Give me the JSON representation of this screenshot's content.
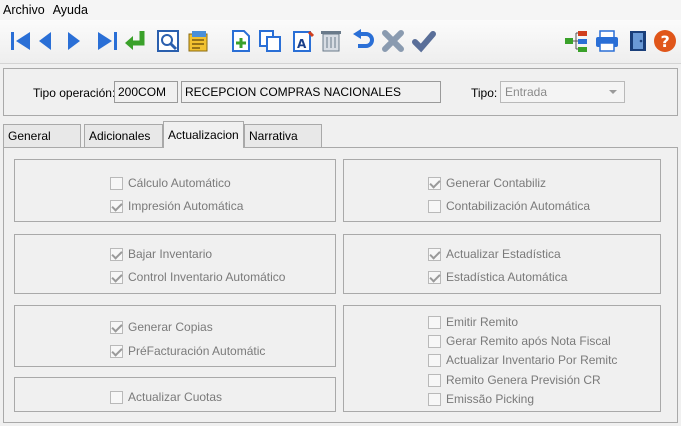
{
  "menu": {
    "archivo": "Archivo",
    "ayuda": "Ayuda"
  },
  "toolbar": {
    "icons": [
      "first-icon",
      "prev-icon",
      "next-icon",
      "last-icon",
      "enter-icon",
      "preview-icon",
      "report-icon",
      "new-icon",
      "copy-icon",
      "edit-icon",
      "delete-icon",
      "undo-icon",
      "cancel-icon",
      "confirm-icon",
      "tree-icon",
      "print-icon",
      "exit-icon",
      "help-icon"
    ]
  },
  "header": {
    "tipo_operacion_label": "Tipo operación:",
    "codigo": "200COM",
    "descripcion": "RECEPCION COMPRAS NACIONALES",
    "tipo_label": "Tipo:",
    "tipo_value": "Entrada"
  },
  "tabs": [
    "General",
    "Adicionales",
    "Actualizacion",
    "Narrativa"
  ],
  "active_tab": "Actualizacion",
  "groups": {
    "g1": {
      "calculo": "Cálculo Automático",
      "impresion": "Impresión Automática"
    },
    "g2": {
      "bajar": "Bajar Inventario",
      "control": "Control Inventario Automático"
    },
    "g3": {
      "copias": "Generar Copias",
      "prefact": "PréFacturación Automátic"
    },
    "g4": {
      "cuotas": "Actualizar Cuotas"
    },
    "g5": {
      "contabiliz": "Generar Contabiliz",
      "contab_auto": "Contabilización Automática"
    },
    "g6": {
      "estadistica": "Actualizar Estadística",
      "estad_auto": "Estadística Automática"
    },
    "g7": {
      "emitir": "Emitir Remito",
      "gerar": "Gerar Remito após Nota Fiscal",
      "act_inv": "Actualizar Inventario Por Remitc",
      "prevision": "Remito Genera Previsión CR",
      "picking": "Emissão Picking"
    }
  },
  "colors": {
    "nav_blue": "#2a6fd6",
    "green": "#3aa12a",
    "help_orange": "#e0561a"
  }
}
